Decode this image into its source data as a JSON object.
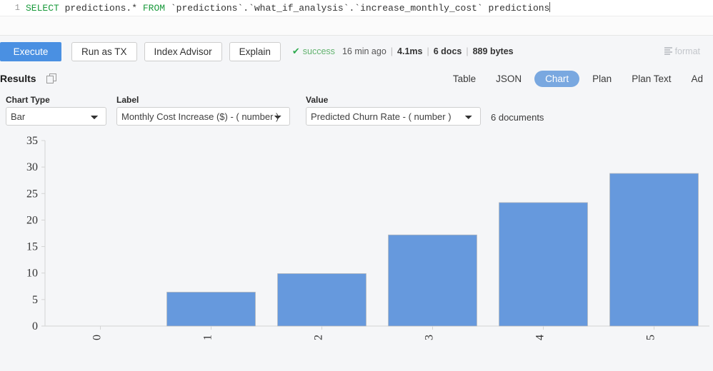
{
  "editor": {
    "line_number": "1",
    "sql_prefix": "SELECT",
    "sql_rest": " predictions.* ",
    "sql_from": "FROM",
    "sql_tail": " `predictions`.`what_if_analysis`.`increase_monthly_cost` predictions"
  },
  "toolbar": {
    "execute_label": "Execute",
    "run_as_tx_label": "Run as TX",
    "index_advisor_label": "Index Advisor",
    "explain_label": "Explain",
    "format_label": "format",
    "status": {
      "check_glyph": "✔",
      "state": "success",
      "time_ago": "16 min ago",
      "duration": "4.1ms",
      "docs": "6 docs",
      "size": "889 bytes",
      "separator": "|"
    }
  },
  "results": {
    "label": "Results",
    "tabs": [
      {
        "label": "Table",
        "active": false
      },
      {
        "label": "JSON",
        "active": false
      },
      {
        "label": "Chart",
        "active": true
      },
      {
        "label": "Plan",
        "active": false
      },
      {
        "label": "Plan Text",
        "active": false
      },
      {
        "label": "Ad",
        "active": false
      }
    ]
  },
  "controls": {
    "chart_type": {
      "label": "Chart Type",
      "value": "Bar"
    },
    "label_field": {
      "label": "Label",
      "value": "Monthly Cost Increase ($) - ( number )"
    },
    "value_field": {
      "label": "Value",
      "value": "Predicted Churn Rate - ( number )"
    },
    "doc_count": "6 documents"
  },
  "colors": {
    "accent": "#4a90e2",
    "bar_fill": "#6699dd",
    "tab_active": "#79a8e0",
    "success": "#63b36f",
    "background": "#f5f6f8"
  },
  "chart_data": {
    "type": "bar",
    "title": "",
    "xlabel": "",
    "ylabel": "",
    "categories": [
      "0",
      "1",
      "2",
      "3",
      "4",
      "5"
    ],
    "values": [
      0,
      6.4,
      9.9,
      17.2,
      23.3,
      28.8
    ],
    "series": [
      {
        "name": "Predicted Churn Rate",
        "values": [
          0,
          6.4,
          9.9,
          17.2,
          23.3,
          28.8
        ]
      }
    ],
    "ylim": [
      0,
      35
    ],
    "yticks": [
      0,
      5,
      10,
      15,
      20,
      25,
      30,
      35
    ],
    "grid": false,
    "legend": "none",
    "tick_label_rotation": -90
  }
}
